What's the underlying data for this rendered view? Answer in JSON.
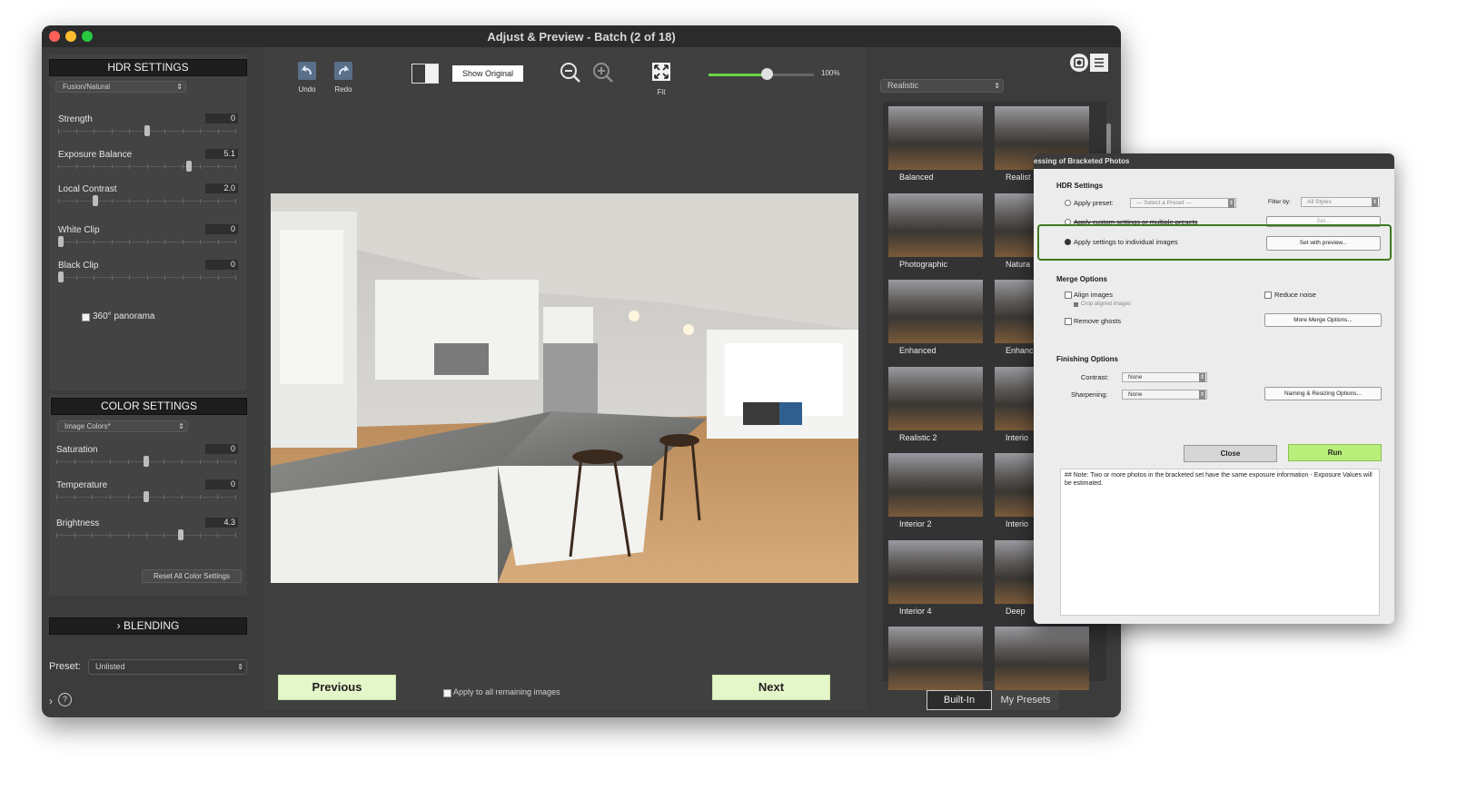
{
  "window": {
    "title": "Adjust & Preview - Batch (2 of 18)"
  },
  "hdr": {
    "title": "HDR SETTINGS",
    "method": "Fusion/Natural",
    "sliders": [
      {
        "label": "Strength",
        "value": "0",
        "pos": 0.5
      },
      {
        "label": "Exposure Balance",
        "value": "5.1",
        "pos": 0.74
      },
      {
        "label": "Local Contrast",
        "value": "2.0",
        "pos": 0.2
      },
      {
        "label": "White Clip",
        "value": "0",
        "pos": 0.0
      },
      {
        "label": "Black Clip",
        "value": "0",
        "pos": 0.0
      }
    ],
    "panorama_label": "360° panorama"
  },
  "color": {
    "title": "COLOR SETTINGS",
    "mode": "Image Colors*",
    "sliders": [
      {
        "label": "Saturation",
        "value": "0",
        "pos": 0.5
      },
      {
        "label": "Temperature",
        "value": "0",
        "pos": 0.5
      },
      {
        "label": "Brightness",
        "value": "4.3",
        "pos": 0.7
      }
    ],
    "reset_label": "Reset All Color Settings"
  },
  "blending": {
    "label": "BLENDING",
    "chevron": "›"
  },
  "preset": {
    "label": "Preset:",
    "value": "Unlisted"
  },
  "footer": {
    "chevron": "›",
    "help": "?"
  },
  "toolbar": {
    "undo": "Undo",
    "redo": "Redo",
    "show_original": "Show Original",
    "fit": "Fit",
    "zoom": "100%",
    "zoom_fraction": 0.55
  },
  "nav": {
    "previous": "Previous",
    "next": "Next",
    "apply_all": "Apply to all remaining images"
  },
  "styles": {
    "dropdown": "Realistic",
    "thumbs_left": [
      "Balanced",
      "Photographic",
      "Enhanced",
      "Realistic 2",
      "Interior 2",
      "Interior 4",
      ""
    ],
    "thumbs_right": [
      "Realist",
      "Natura",
      "Enhanc",
      "Interio",
      "Interio",
      "Deep",
      ""
    ],
    "tab_builtin": "Built-In",
    "tab_mypresets": "My Presets"
  },
  "dialog": {
    "title": "essing of Bracketed Photos",
    "hdr_settings": "HDR Settings",
    "apply_preset": "Apply preset:",
    "preset_select": "--- Select a Preset ---",
    "filter_by": "Filter by:",
    "filter_value": "All Styles",
    "apply_custom": "Apply custom settings or multiple presets",
    "set_button": "Set...",
    "apply_individual": "Apply settings to individual images",
    "set_preview": "Set with preview...",
    "merge_options": "Merge Options",
    "align_images": "Align images",
    "crop_aligned": "Crop aligned images",
    "remove_ghosts": "Remove ghosts",
    "reduce_noise": "Reduce noise",
    "more_merge": "More Merge Options...",
    "finishing_options": "Finishing Options",
    "contrast_label": "Contrast:",
    "contrast_value": "None",
    "sharpening_label": "Sharpening:",
    "sharpening_value": "None",
    "naming": "Naming & Resizing Options...",
    "close": "Close",
    "run": "Run",
    "note": "## Note: Two or more photos in the bracketed set have the same exposure information - Exposure Values will be estimated."
  },
  "colors": {
    "highlight": "#3d7a1f",
    "accent_green": "#e4f7c9",
    "run_green": "#b8ee7a"
  }
}
